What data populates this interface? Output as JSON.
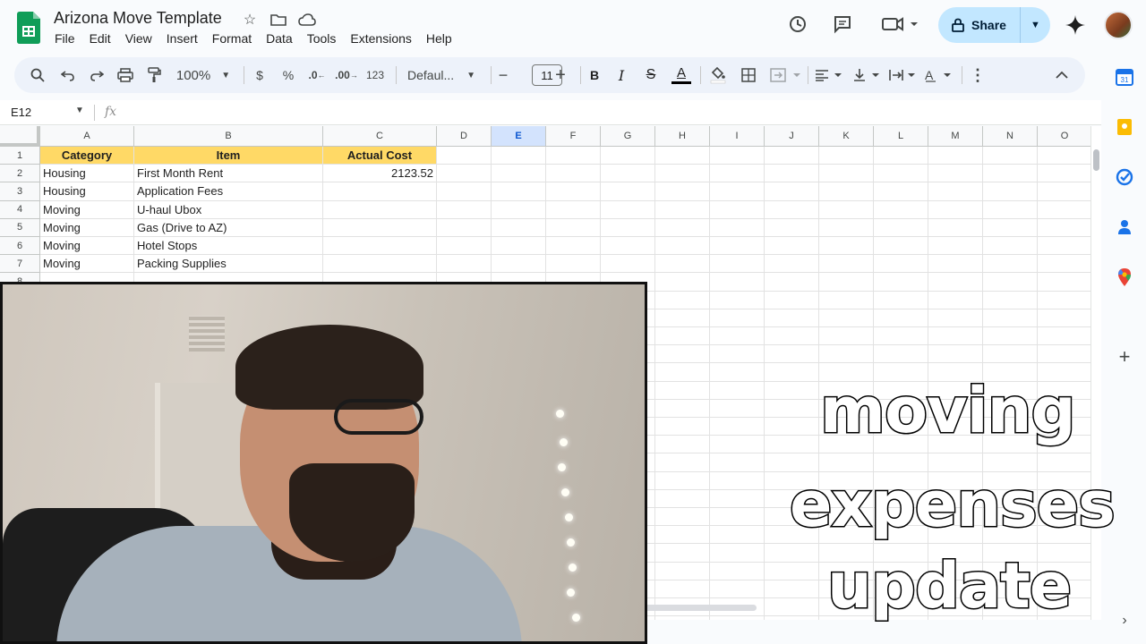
{
  "app": {
    "doc_title": "Arizona Move Template",
    "menu": [
      "File",
      "Edit",
      "View",
      "Insert",
      "Format",
      "Data",
      "Tools",
      "Extensions",
      "Help"
    ],
    "share_label": "Share"
  },
  "toolbar": {
    "zoom": "100%",
    "currency": "$",
    "percent": "%",
    "decrease_decimal": ".0",
    "increase_decimal": ".00",
    "number_format": "123",
    "font_family": "Defaul...",
    "font_size": "11",
    "bold": "B",
    "italic": "I",
    "strikethrough": "S",
    "text_color": "A"
  },
  "formula_bar": {
    "cell_ref": "E12",
    "fx": "fx"
  },
  "sheet": {
    "columns": [
      "A",
      "B",
      "C",
      "D",
      "E",
      "F",
      "G",
      "H",
      "I",
      "J",
      "K",
      "L",
      "M",
      "N",
      "O"
    ],
    "selected_column": "E",
    "row_numbers": [
      "1",
      "2",
      "3",
      "4",
      "5",
      "6",
      "7",
      "8"
    ],
    "header_row": [
      "Category",
      "Item",
      "Actual Cost"
    ],
    "rows": [
      {
        "category": "Housing",
        "item": "First Month Rent",
        "cost": "2123.52"
      },
      {
        "category": "Housing",
        "item": "Application Fees",
        "cost": ""
      },
      {
        "category": "Moving",
        "item": "U-haul Ubox",
        "cost": ""
      },
      {
        "category": "Moving",
        "item": "Gas (Drive to AZ)",
        "cost": ""
      },
      {
        "category": "Moving",
        "item": "Hotel Stops",
        "cost": ""
      },
      {
        "category": "Moving",
        "item": "Packing Supplies",
        "cost": ""
      }
    ]
  },
  "overlay": {
    "line1": "moving",
    "line2": "expenses",
    "line3": "update"
  },
  "colors": {
    "header_fill": "#ffd966",
    "share_bg": "#c2e7ff",
    "selected_col": "#d3e3fd"
  }
}
